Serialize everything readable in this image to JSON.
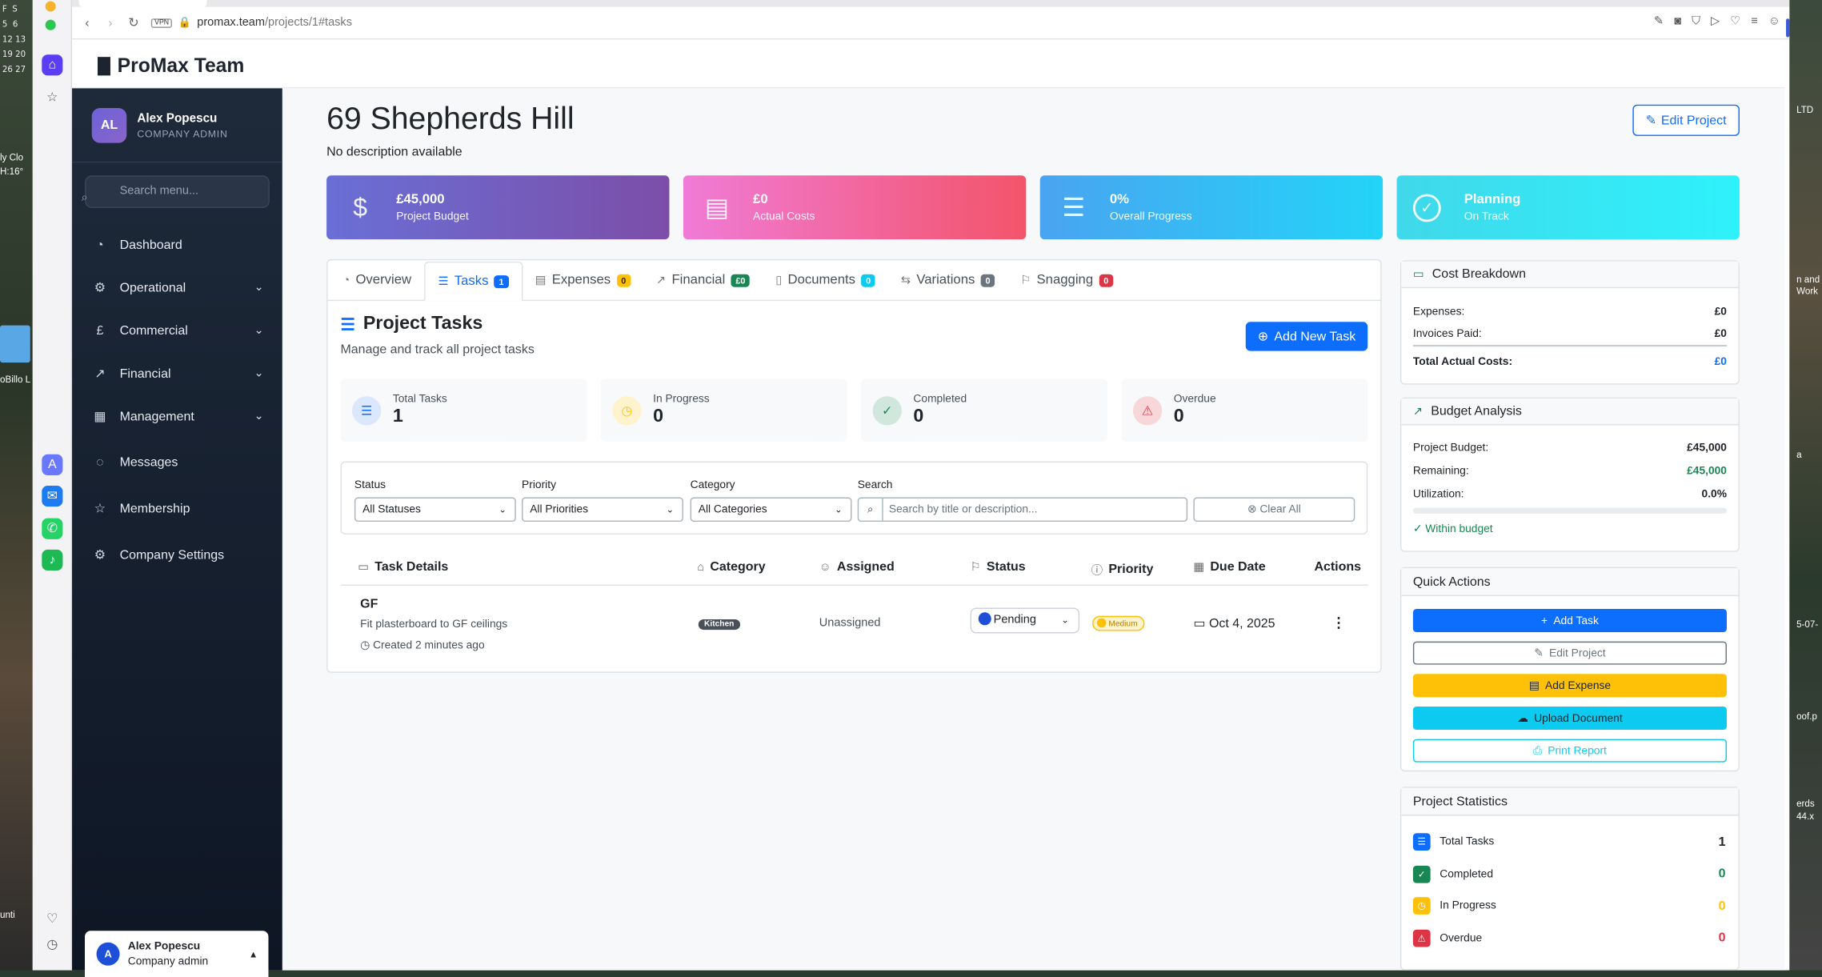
{
  "desktop": {
    "calendar": [
      "F",
      "5",
      "12",
      "19",
      "26",
      "S",
      "6",
      "13",
      "20",
      "27"
    ],
    "weather": [
      "ly Clo",
      "H:16°"
    ],
    "left_labels": [
      "oBillo L",
      "unti"
    ],
    "right_labels": [
      "LTD",
      "n and",
      "Work",
      "a",
      "5-07-",
      "oof.p",
      "erds",
      "44.x"
    ]
  },
  "browser": {
    "url_host": "promax.team",
    "url_path": "/projects/1#tasks",
    "vpn": "VPN"
  },
  "app": {
    "brand": "ProMax Team",
    "user": {
      "initials": "AL",
      "name": "Alex Popescu",
      "role": "COMPANY ADMIN"
    },
    "search_placeholder": "Search menu...",
    "menu": [
      {
        "label": "Dashboard",
        "icon": "dashboard-icon"
      },
      {
        "label": "Operational",
        "icon": "gear-icon"
      },
      {
        "label": "Commercial",
        "icon": "pound-icon"
      },
      {
        "label": "Financial",
        "icon": "chart-icon"
      },
      {
        "label": "Management",
        "icon": "building-icon"
      },
      {
        "label": "Messages",
        "icon": "chat-icon"
      },
      {
        "label": "Membership",
        "icon": "star-icon"
      },
      {
        "label": "Company Settings",
        "icon": "settings-icon"
      }
    ],
    "footer_user": {
      "initial": "A",
      "name": "Alex Popescu",
      "role": "Company admin"
    }
  },
  "project": {
    "title": "69 Shepherds Hill",
    "description": "No description available",
    "edit_label": "Edit Project",
    "stats": [
      {
        "value": "£45,000",
        "label": "Project Budget",
        "icon": "$"
      },
      {
        "value": "£0",
        "label": "Actual Costs",
        "icon": "▤"
      },
      {
        "value": "0%",
        "label": "Overall Progress",
        "icon": "☰"
      },
      {
        "value": "Planning",
        "label": "On Track",
        "icon": "✓"
      }
    ]
  },
  "tabs": [
    {
      "label": "Overview",
      "badge": ""
    },
    {
      "label": "Tasks",
      "badge": "1"
    },
    {
      "label": "Expenses",
      "badge": "0"
    },
    {
      "label": "Financial",
      "badge": "£0"
    },
    {
      "label": "Documents",
      "badge": "0"
    },
    {
      "label": "Variations",
      "badge": "0"
    },
    {
      "label": "Snagging",
      "badge": "0"
    }
  ],
  "tasks_panel": {
    "title": "Project Tasks",
    "subtitle": "Manage and track all project tasks",
    "add_label": "Add New Task",
    "summary": [
      {
        "label": "Total Tasks",
        "value": "1"
      },
      {
        "label": "In Progress",
        "value": "0"
      },
      {
        "label": "Completed",
        "value": "0"
      },
      {
        "label": "Overdue",
        "value": "0"
      }
    ],
    "filters": {
      "status_label": "Status",
      "status_value": "All Statuses",
      "priority_label": "Priority",
      "priority_value": "All Priorities",
      "category_label": "Category",
      "category_value": "All Categories",
      "search_label": "Search",
      "search_placeholder": "Search by title or description...",
      "clear_label": "Clear All"
    },
    "columns": [
      "Task Details",
      "Category",
      "Assigned",
      "Status",
      "Priority",
      "Due Date",
      "Actions"
    ],
    "rows": [
      {
        "name": "GF",
        "description": "Fit plasterboard to GF ceilings",
        "created": "Created 2 minutes ago",
        "category": "Kitchen",
        "assigned": "Unassigned",
        "status": "Pending",
        "priority": "Medium",
        "due": "Oct 4, 2025"
      }
    ]
  },
  "cost_breakdown": {
    "title": "Cost Breakdown",
    "rows": [
      {
        "label": "Expenses:",
        "value": "£0"
      },
      {
        "label": "Invoices Paid:",
        "value": "£0"
      }
    ],
    "total_label": "Total Actual Costs:",
    "total_value": "£0"
  },
  "budget_analysis": {
    "title": "Budget Analysis",
    "rows": [
      {
        "label": "Project Budget:",
        "value": "£45,000"
      },
      {
        "label": "Remaining:",
        "value": "£45,000"
      },
      {
        "label": "Utilization:",
        "value": "0.0%"
      }
    ],
    "utilization_fraction": 0.0,
    "status": "Within budget"
  },
  "quick_actions": {
    "title": "Quick Actions",
    "buttons": [
      "Add Task",
      "Edit Project",
      "Add Expense",
      "Upload Document",
      "Print Report"
    ]
  },
  "project_statistics": {
    "title": "Project Statistics",
    "rows": [
      {
        "label": "Total Tasks",
        "value": "1"
      },
      {
        "label": "Completed",
        "value": "0"
      },
      {
        "label": "In Progress",
        "value": "0"
      },
      {
        "label": "Overdue",
        "value": "0"
      }
    ]
  },
  "colors": {
    "primary": "#0d6efd",
    "success": "#198754",
    "warning": "#ffc107",
    "danger": "#dc3545",
    "info": "#0dcaf0",
    "sidebar": "#1e2a3a"
  }
}
